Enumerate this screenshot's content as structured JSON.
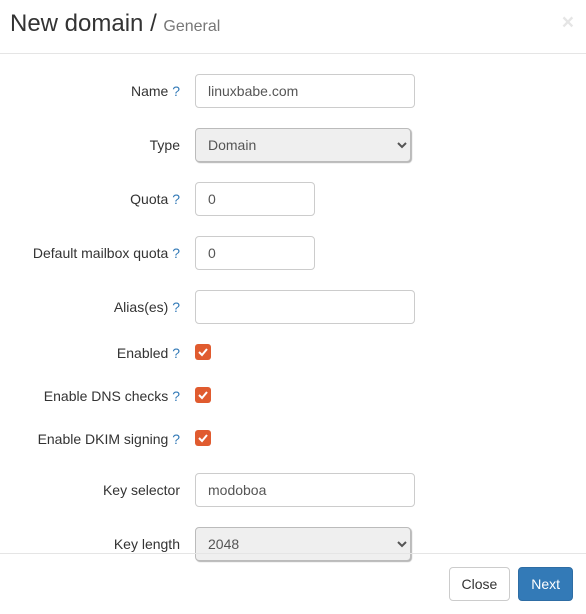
{
  "header": {
    "title": "New domain /",
    "subtitle": "General",
    "close_symbol": "×"
  },
  "form": {
    "name": {
      "label": "Name",
      "help": "?",
      "value": "linuxbabe.com"
    },
    "type": {
      "label": "Type",
      "selected": "Domain"
    },
    "quota": {
      "label": "Quota",
      "help": "?",
      "value": "0"
    },
    "default_mailbox_quota": {
      "label": "Default mailbox quota",
      "help": "?",
      "value": "0"
    },
    "aliases": {
      "label": "Alias(es)",
      "help": "?",
      "value": ""
    },
    "enabled": {
      "label": "Enabled",
      "help": "?",
      "checked": true
    },
    "enable_dns_checks": {
      "label": "Enable DNS checks",
      "help": "?",
      "checked": true
    },
    "enable_dkim_signing": {
      "label": "Enable DKIM signing",
      "help": "?",
      "checked": true
    },
    "key_selector": {
      "label": "Key selector",
      "value": "modoboa"
    },
    "key_length": {
      "label": "Key length",
      "selected": "2048"
    }
  },
  "footer": {
    "close_label": "Close",
    "next_label": "Next"
  }
}
